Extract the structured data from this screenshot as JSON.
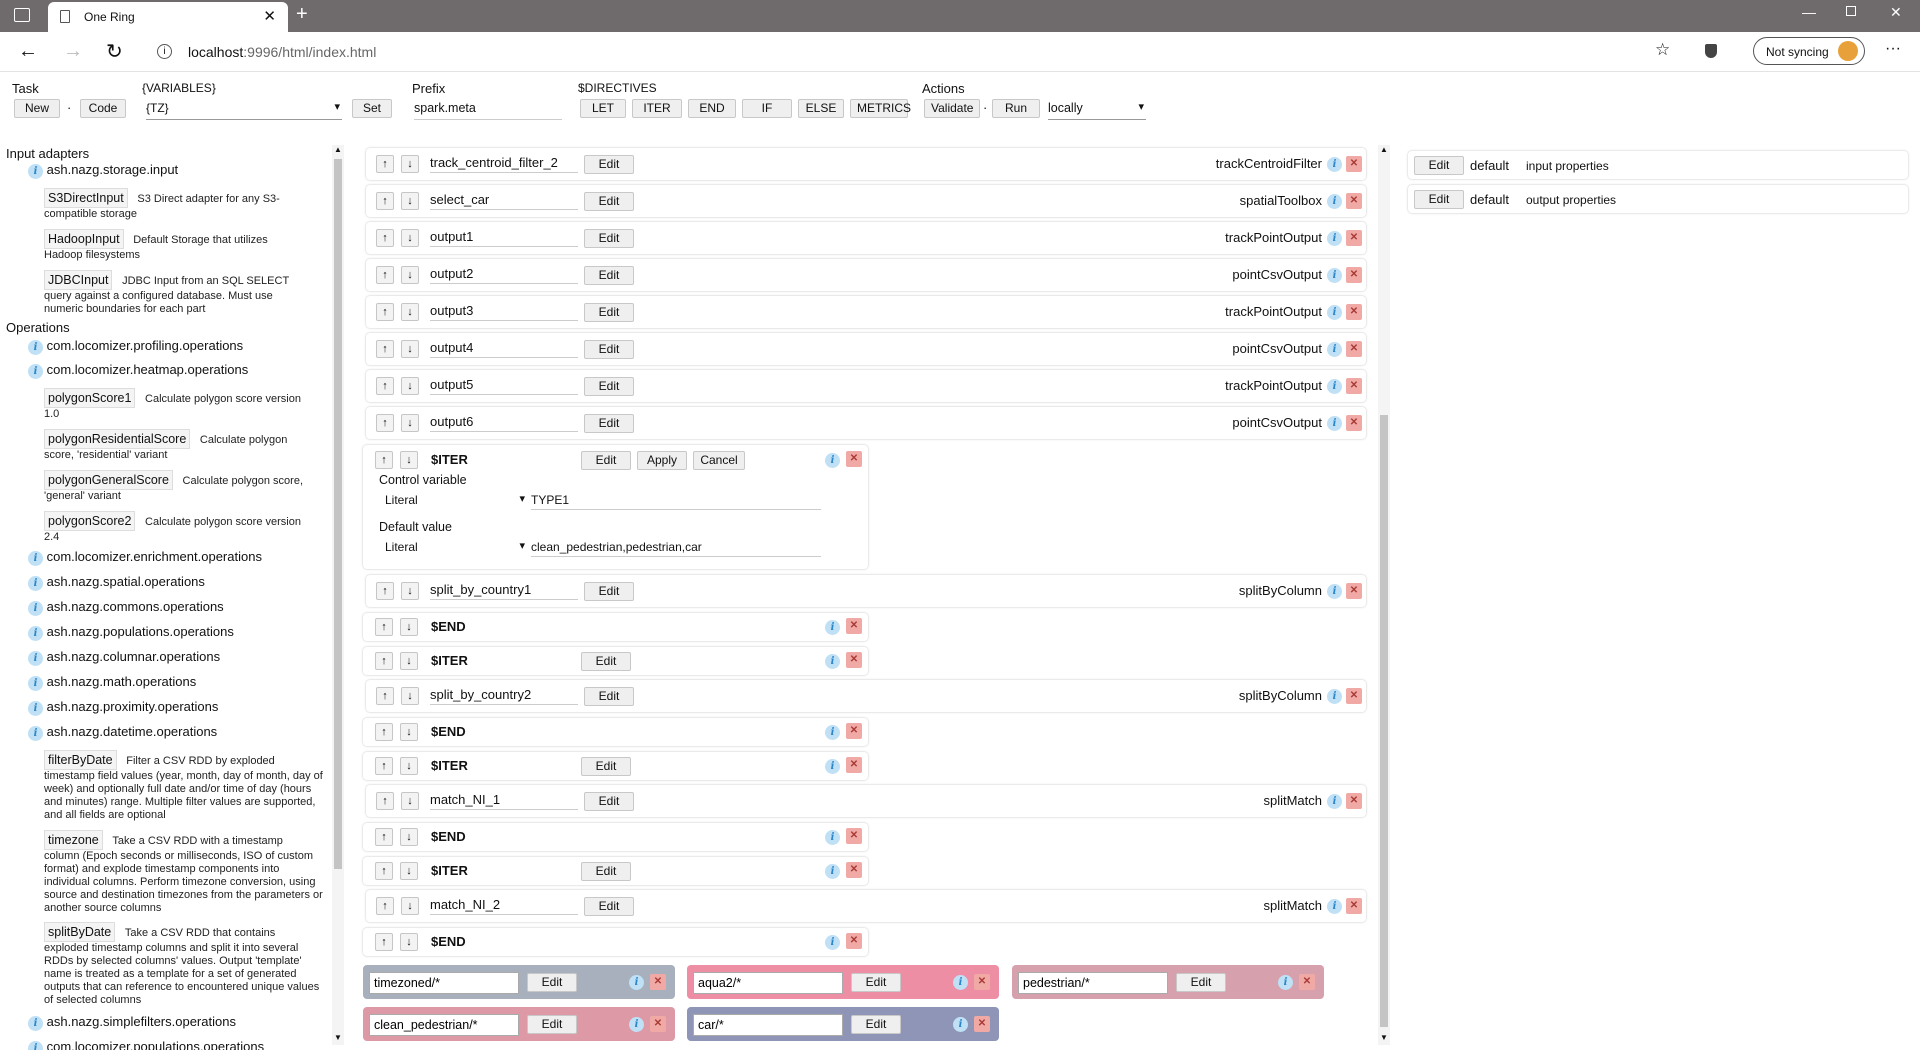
{
  "browser": {
    "tab_title": "One Ring",
    "url_host": "localhost",
    "url_rest": ":9996/html/index.html",
    "sync_label": "Not syncing"
  },
  "toolbar": {
    "task_label": "Task",
    "new_label": "New",
    "code_label": "Code",
    "sep": "·",
    "variables_label": "{VARIABLES}",
    "variables_value": "{TZ}",
    "set_label": "Set",
    "prefix_label": "Prefix",
    "prefix_value": "spark.meta",
    "directives_label": "$DIRECTIVES",
    "directives": [
      "LET",
      "ITER",
      "END",
      "IF",
      "ELSE",
      "METRICS"
    ],
    "actions_label": "Actions",
    "validate_label": "Validate",
    "run_label": "Run",
    "run_mode": "locally"
  },
  "sidebar": {
    "input_adapters_label": "Input adapters",
    "storage_pkg": "ash.nazg.storage.input",
    "adapters": [
      {
        "name": "S3DirectInput",
        "desc1": "S3 Direct adapter for any S3-",
        "desc2": "compatible storage"
      },
      {
        "name": "HadoopInput",
        "desc1": "Default Storage that utilizes",
        "desc2": "Hadoop filesystems"
      },
      {
        "name": "JDBCInput",
        "desc1": "JDBC Input from an SQL SELECT",
        "desc2": "query against a configured database. Must use numeric boundaries for each part"
      }
    ],
    "operations_label": "Operations",
    "pkgs": [
      "com.locomizer.profiling.operations",
      "com.locomizer.heatmap.operations",
      "com.locomizer.enrichment.operations",
      "ash.nazg.spatial.operations",
      "ash.nazg.commons.operations",
      "ash.nazg.populations.operations",
      "ash.nazg.columnar.operations",
      "ash.nazg.math.operations",
      "ash.nazg.proximity.operations",
      "ash.nazg.datetime.operations",
      "ash.nazg.simplefilters.operations",
      "com.locomizer.populations.operations"
    ],
    "heatmap_ops": [
      {
        "name": "polygonScore1",
        "desc1": "Calculate polygon score version",
        "desc2": "1.0"
      },
      {
        "name": "polygonResidentialScore",
        "desc1": "Calculate polygon",
        "desc2": "score, 'residential' variant"
      },
      {
        "name": "polygonGeneralScore",
        "desc1": "Calculate polygon score,",
        "desc2": "'general' variant"
      },
      {
        "name": "polygonScore2",
        "desc1": "Calculate polygon score version",
        "desc2": "2.4"
      }
    ],
    "datetime_ops": [
      {
        "name": "filterByDate",
        "desc1": "Filter a CSV RDD by exploded",
        "desc2": "timestamp field values (year, month, day of month, day of week) and optionally full date and/or time of day (hours and minutes) range. Multiple filter values are supported, and all fields are optional"
      },
      {
        "name": "timezone",
        "desc1": "Take a CSV RDD with a timestamp",
        "desc2": "column (Epoch seconds or milliseconds, ISO of custom format) and explode timestamp components into individual columns. Perform timezone conversion, using source and destination timezones from the parameters or another source columns"
      },
      {
        "name": "splitByDate",
        "desc1": "Take a CSV RDD that contains",
        "desc2": "exploded timestamp columns and split it into several RDDs by selected columns' values. Output 'template' name is treated as a template for a set of generated outputs that can reference to encountered unique values of selected columns"
      }
    ]
  },
  "main": {
    "edit_label": "Edit",
    "ops": [
      {
        "name": "track_centroid_filter_2",
        "op": "trackCentroidFilter"
      },
      {
        "name": "select_car",
        "op": "spatialToolbox"
      },
      {
        "name": "output1",
        "op": "trackPointOutput"
      },
      {
        "name": "output2",
        "op": "pointCsvOutput"
      },
      {
        "name": "output3",
        "op": "trackPointOutput"
      },
      {
        "name": "output4",
        "op": "pointCsvOutput"
      },
      {
        "name": "output5",
        "op": "trackPointOutput"
      },
      {
        "name": "output6",
        "op": "pointCsvOutput"
      }
    ],
    "iter_editor": {
      "kw": "$ITER",
      "apply": "Apply",
      "cancel": "Cancel",
      "control_label": "Control variable",
      "control_type": "Literal",
      "control_value": "TYPE1",
      "default_label": "Default value",
      "default_type": "Literal",
      "default_value": "clean_pedestrian,pedestrian,car"
    },
    "op_split1": {
      "name": "split_by_country1",
      "op": "splitByColumn"
    },
    "op_split2": {
      "name": "split_by_country2",
      "op": "splitByColumn"
    },
    "op_match1": {
      "name": "match_NI_1",
      "op": "splitMatch"
    },
    "op_match2": {
      "name": "match_NI_2",
      "op": "splitMatch"
    },
    "end_kw": "$END",
    "iter_kw": "$ITER",
    "datastreams": [
      {
        "name": "timezoned/*",
        "color": "#a7b0bc"
      },
      {
        "name": "aqua2/*",
        "color": "#ee8ea5"
      },
      {
        "name": "pedestrian/*",
        "color": "#d6a0ad"
      },
      {
        "name": "clean_pedestrian/*",
        "color": "#dd9aa6"
      },
      {
        "name": "car/*",
        "color": "#8f95b6"
      }
    ]
  },
  "right": {
    "rows": [
      {
        "edit": "Edit",
        "layer": "default",
        "props": "input properties"
      },
      {
        "edit": "Edit",
        "layer": "default",
        "props": "output properties"
      }
    ]
  },
  "colors": {
    "accent": "#2a86c9",
    "close_bg": "#f0a9a5"
  }
}
